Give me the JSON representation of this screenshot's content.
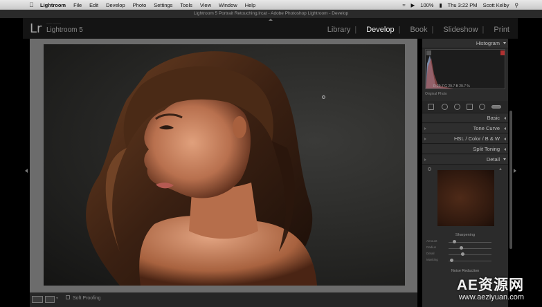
{
  "menubar": {
    "app": "Lightroom",
    "items": [
      "File",
      "Edit",
      "Develop",
      "Photo",
      "Settings",
      "Tools",
      "View",
      "Window",
      "Help"
    ],
    "battery": "100%",
    "clock": "Thu 3:22 PM",
    "user": "Scott Kelby"
  },
  "window_title": "Lightroom 5 Portrait Retouching.lrcat - Adobe Photoshop Lightroom - Develop",
  "identity": {
    "logo": "Lr",
    "product": "Lightroom 5"
  },
  "modules": {
    "library": "Library",
    "develop": "Develop",
    "book": "Book",
    "slideshow": "Slideshow",
    "print": "Print",
    "active": "Develop"
  },
  "toolbar": {
    "soft_proofing": "Soft Proofing"
  },
  "panel": {
    "histogram": "Histogram",
    "histogram_values": "R 29.7  G 29.7  B 29.7 %",
    "original_photo": "Original Photo",
    "basic": "Basic",
    "tone_curve": "Tone Curve",
    "hsl": "HSL / Color / B & W",
    "split_toning": "Split Toning",
    "detail": "Detail",
    "sharpening": "Sharpening",
    "sliders": [
      "Amount",
      "Radius",
      "Detail",
      "Masking"
    ],
    "noise_reduction": "Noise Reduction"
  },
  "watermark": {
    "title": "AE资源网",
    "url": "www.aeziyuan.com"
  },
  "colors": {
    "menubar": "#d6d6d6",
    "app_bg": "#141414",
    "panel_bg": "#2b2b2b",
    "canvas_bg": "#6c6c6c"
  }
}
